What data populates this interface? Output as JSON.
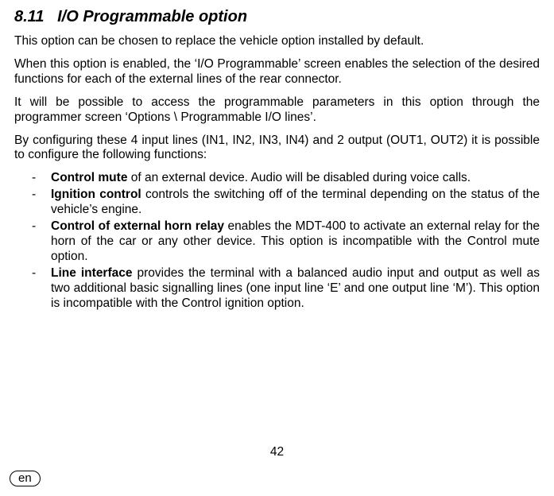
{
  "heading": {
    "number": "8.11",
    "title": "I/O Programmable option"
  },
  "paragraphs": {
    "p1": "This option can be chosen to replace the vehicle option installed by default.",
    "p2": "When this option is enabled, the ‘I/O Programmable’ screen enables the selection of the desired functions for each of the external lines of the rear connector.",
    "p3": "It will be possible to access the programmable parameters in this option through the programmer screen ‘Options \\ Programmable I/O lines’.",
    "p4": "By configuring these 4 input lines (IN1, IN2, IN3, IN4) and 2 output (OUT1, OUT2) it is possible to configure the following functions:"
  },
  "bullets": {
    "b1": {
      "label": "Control mute",
      "rest": " of an external device. Audio will be disabled during voice calls."
    },
    "b2": {
      "label": "Ignition control",
      "rest": " controls the switching off of the terminal depending on the status of the vehicle’s engine."
    },
    "b3": {
      "label": "Control of external horn relay",
      "rest": " enables the MDT-400 to activate an external relay for the horn of the car or any other device. This option is incompatible with the Control mute option."
    },
    "b4": {
      "label": "Line interface",
      "rest": " provides the terminal with a balanced audio input and output as well as two additional basic signalling lines (one input line ‘E’ and one output line ‘M’). This option is incompatible with the Control ignition option."
    }
  },
  "footer": {
    "pagenum": "42",
    "lang": "en"
  }
}
